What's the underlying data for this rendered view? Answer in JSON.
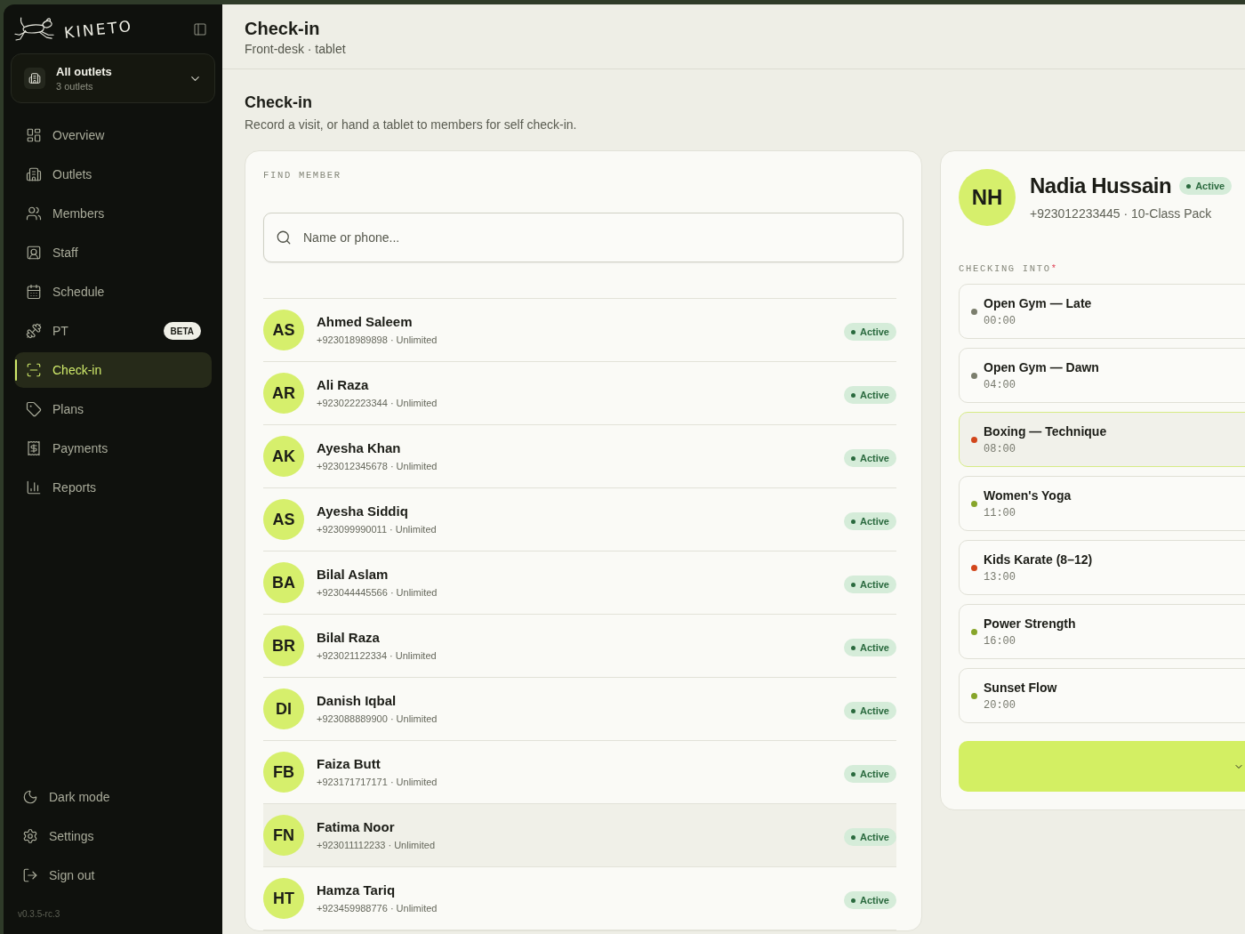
{
  "sidebar": {
    "brand": "KINETO",
    "outlet_selector": {
      "title": "All outlets",
      "subtitle": "3 outlets"
    },
    "nav_items": [
      {
        "label": "Overview",
        "selected": false
      },
      {
        "label": "Outlets",
        "selected": false
      },
      {
        "label": "Members",
        "selected": false
      },
      {
        "label": "Staff",
        "selected": false
      },
      {
        "label": "Schedule",
        "selected": false
      },
      {
        "label": "PT",
        "badge": "BETA",
        "selected": false
      },
      {
        "label": "Check-in",
        "selected": true
      },
      {
        "label": "Plans",
        "selected": false
      },
      {
        "label": "Payments",
        "selected": false
      },
      {
        "label": "Reports",
        "selected": false
      }
    ],
    "footer_items": [
      {
        "label": "Dark mode"
      },
      {
        "label": "Settings"
      },
      {
        "label": "Sign out"
      }
    ],
    "version": "v0.3.5-rc.3"
  },
  "header": {
    "title": "Check-in",
    "subtitle": "Front-desk · tablet"
  },
  "page": {
    "title": "Check-in",
    "description": "Record a visit, or hand a tablet to members for self check-in."
  },
  "find_member": {
    "label": "FIND MEMBER",
    "search": {
      "placeholder": "Name or phone..."
    },
    "members": [
      {
        "initials": "AS",
        "name": "Ahmed Saleem",
        "detail": "+923018989898 · Unlimited",
        "status": "Active",
        "highlighted": false
      },
      {
        "initials": "AR",
        "name": "Ali Raza",
        "detail": "+923022223344 · Unlimited",
        "status": "Active",
        "highlighted": false
      },
      {
        "initials": "AK",
        "name": "Ayesha Khan",
        "detail": "+923012345678 · Unlimited",
        "status": "Active",
        "highlighted": false
      },
      {
        "initials": "AS",
        "name": "Ayesha Siddiq",
        "detail": "+923099990011 · Unlimited",
        "status": "Active",
        "highlighted": false
      },
      {
        "initials": "BA",
        "name": "Bilal Aslam",
        "detail": "+923044445566 · Unlimited",
        "status": "Active",
        "highlighted": false
      },
      {
        "initials": "BR",
        "name": "Bilal Raza",
        "detail": "+923021122334 · Unlimited",
        "status": "Active",
        "highlighted": false
      },
      {
        "initials": "DI",
        "name": "Danish Iqbal",
        "detail": "+923088889900 · Unlimited",
        "status": "Active",
        "highlighted": false
      },
      {
        "initials": "FB",
        "name": "Faiza Butt",
        "detail": "+923171717171 · Unlimited",
        "status": "Active",
        "highlighted": false
      },
      {
        "initials": "FN",
        "name": "Fatima Noor",
        "detail": "+923011112233 · Unlimited",
        "status": "Active",
        "highlighted": true
      },
      {
        "initials": "HT",
        "name": "Hamza Tariq",
        "detail": "+923459988776 · Unlimited",
        "status": "Active",
        "highlighted": false
      }
    ]
  },
  "member_panel": {
    "initials": "NH",
    "name": "Nadia Hussain",
    "status": "Active",
    "detail": "+923012233445 · 10-Class Pack",
    "checking_into": {
      "label": "CHECKING INTO",
      "required_mark": "*",
      "classes": [
        {
          "name": "Open Gym — Late",
          "time": "00:00",
          "color": "#7b7e6d",
          "selected": false
        },
        {
          "name": "Open Gym — Dawn",
          "time": "04:00",
          "color": "#7b7e6d",
          "selected": false
        },
        {
          "name": "Boxing — Technique",
          "time": "08:00",
          "color": "#d2461b",
          "selected": true
        },
        {
          "name": "Women's Yoga",
          "time": "11:00",
          "color": "#87a52a",
          "selected": false
        },
        {
          "name": "Kids Karate (8–12)",
          "time": "13:00",
          "color": "#d2461b",
          "selected": false
        },
        {
          "name": "Power Strength",
          "time": "16:00",
          "color": "#87a52a",
          "selected": false
        },
        {
          "name": "Sunset Flow",
          "time": "20:00",
          "color": "#87a52a",
          "selected": false
        }
      ]
    }
  }
}
